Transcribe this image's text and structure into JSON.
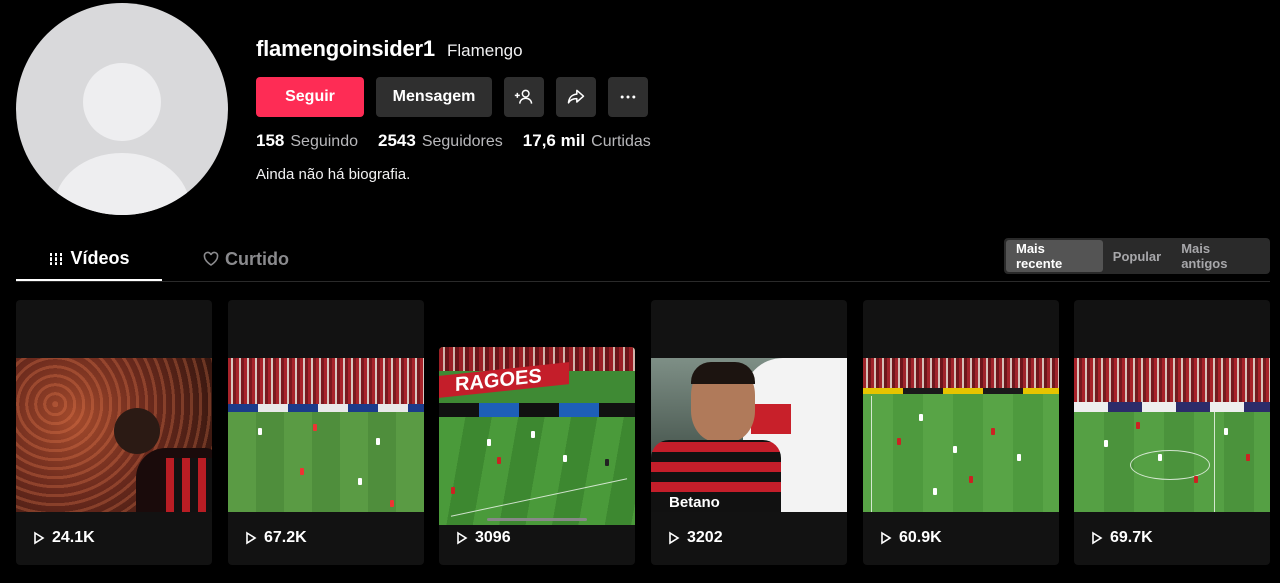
{
  "profile": {
    "username": "flamengoinsider1",
    "nickname": "Flamengo",
    "bio": "Ainda não há biografia."
  },
  "actions": {
    "follow_label": "Seguir",
    "message_label": "Mensagem"
  },
  "stats": {
    "following_count": "158",
    "following_label": "Seguindo",
    "followers_count": "2543",
    "followers_label": "Seguidores",
    "likes_count": "17,6 mil",
    "likes_label": "Curtidas"
  },
  "tabs": {
    "videos": "Vídeos",
    "liked": "Curtido"
  },
  "sort": {
    "options": [
      "Mais recente",
      "Popular",
      "Mais antigos"
    ],
    "active": "Mais recente"
  },
  "videos": [
    {
      "views": "24.1K"
    },
    {
      "views": "67.2K"
    },
    {
      "views": "3096"
    },
    {
      "views": "3202"
    },
    {
      "views": "60.9K"
    },
    {
      "views": "69.7K"
    }
  ],
  "colors": {
    "accent": "#fe2c55",
    "background": "#000000",
    "button": "#2f2f2f"
  }
}
